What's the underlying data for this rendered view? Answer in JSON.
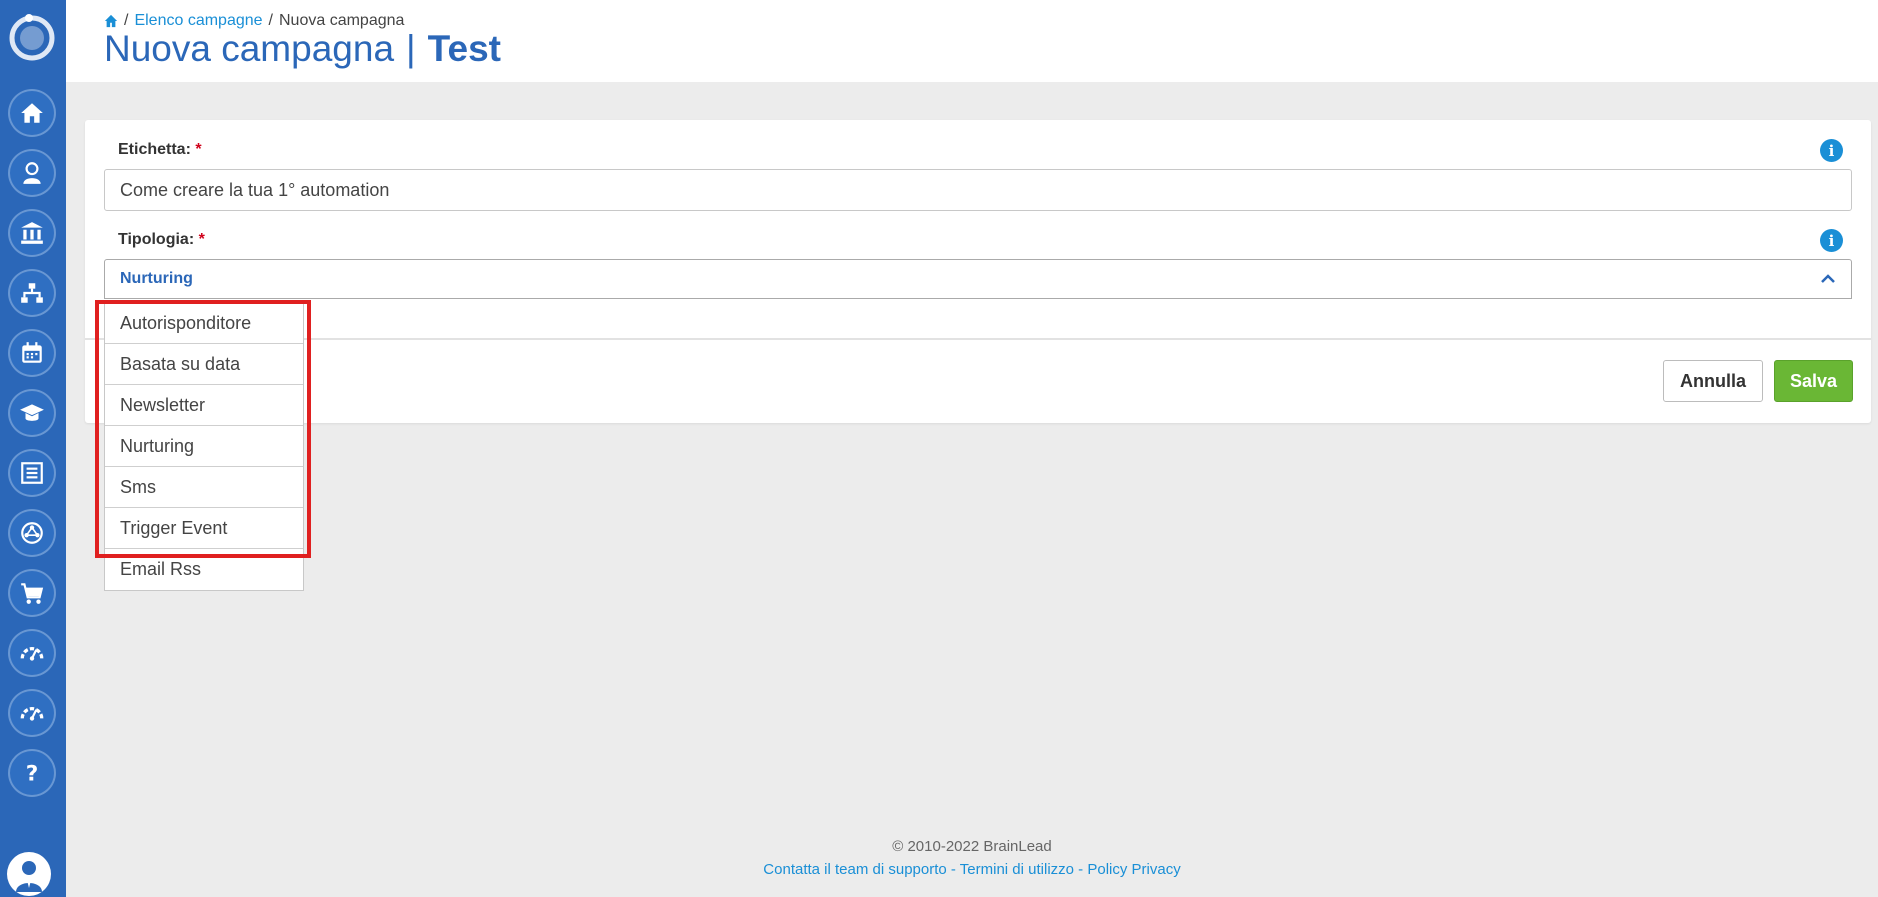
{
  "breadcrumb": {
    "separator": "/",
    "link": "Elenco campagne",
    "current": "Nuova campagna"
  },
  "title": {
    "main": "Nuova campagna",
    "separator": "|",
    "bold": "Test"
  },
  "form": {
    "label_field": {
      "label": "Etichetta:",
      "required": "*",
      "value": "Come creare la tua 1° automation"
    },
    "type_field": {
      "label": "Tipologia:",
      "required": "*",
      "selected": "Nurturing",
      "options": [
        "Autorisponditore",
        "Basata su data",
        "Newsletter",
        "Nurturing",
        "Sms",
        "Trigger Event",
        "Email Rss"
      ]
    },
    "info_icon_glyph": "i",
    "cancel_label": "Annulla",
    "save_label": "Salva"
  },
  "footer": {
    "copyright": "© 2010-2022 BrainLead",
    "support": "Contatta il team di supporto",
    "terms": "Termini di utilizzo",
    "privacy": "Policy Privacy",
    "dash": " - "
  },
  "sidebar_icons": [
    "home-icon",
    "person-icon",
    "bank-icon",
    "sitemap-icon",
    "calendar-icon",
    "graduation-cap-icon",
    "list-icon",
    "network-icon",
    "cart-icon",
    "gauge-icon",
    "gauge-icon",
    "help-icon"
  ],
  "colors": {
    "primary": "#2b67b8",
    "link": "#1a8fd6",
    "save": "#6ab735",
    "highlight": "#e02020",
    "required": "#d0021b"
  }
}
